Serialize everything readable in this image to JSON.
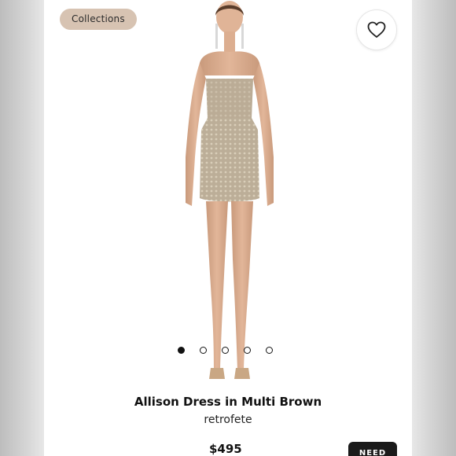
{
  "header": {
    "collections_label": "Collections"
  },
  "icons": {
    "favorite": "heart-outline-icon"
  },
  "product": {
    "name": "Allison Dress in Multi Brown",
    "brand": "retrofete",
    "price": "$495"
  },
  "gallery": {
    "image_count": 5,
    "active_index": 0
  },
  "cta": {
    "label": "NEED"
  },
  "colors": {
    "chip_bg": "#d7c3b2",
    "accent_dark": "#1a1a1a"
  }
}
